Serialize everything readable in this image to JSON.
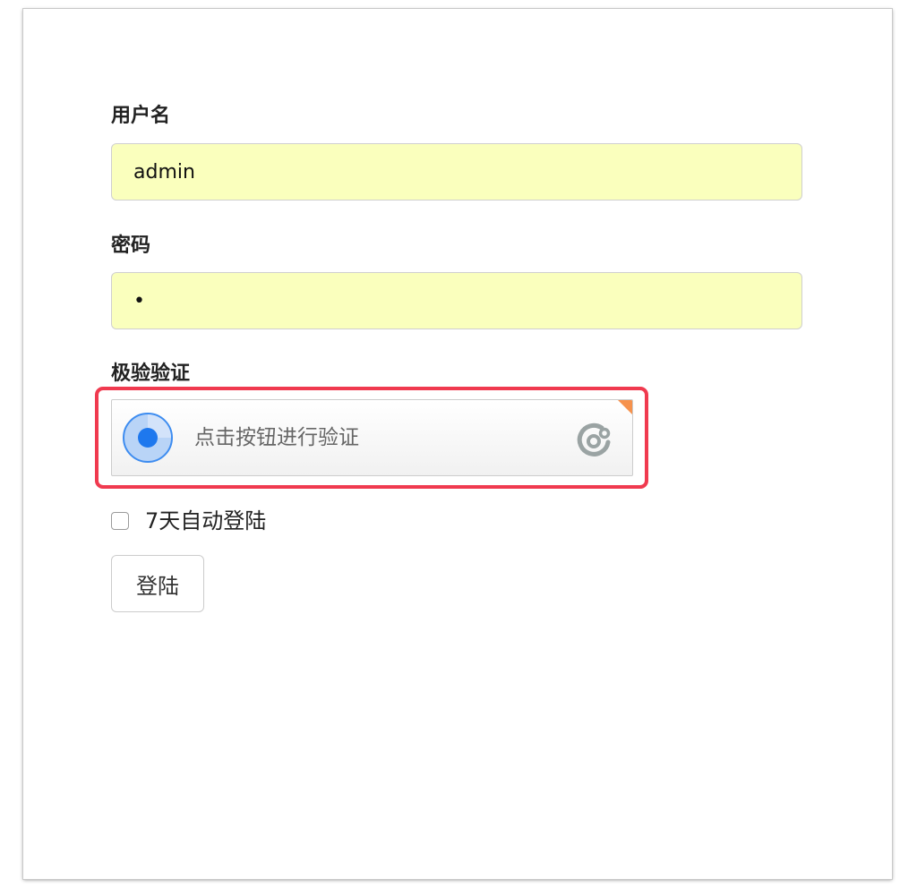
{
  "form": {
    "username": {
      "label": "用户名",
      "value": "admin"
    },
    "password": {
      "label": "密码",
      "value": "•"
    },
    "captcha": {
      "label": "极验验证",
      "button_text": "点击按钮进行验证",
      "icons": {
        "left": "radar-icon",
        "right": "geetest-logo-icon"
      },
      "accent_color": "#3d8cf0",
      "highlight_color": "#f03a4f",
      "corner_color": "#f6924d"
    },
    "remember": {
      "label": "7天自动登陆",
      "checked": false
    },
    "submit": {
      "label": "登陆"
    },
    "autofill_color": "#faffbd"
  }
}
